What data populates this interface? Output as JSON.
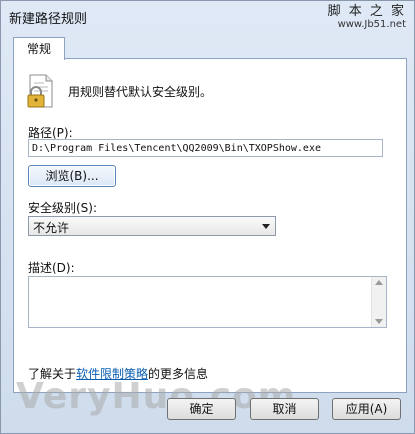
{
  "window": {
    "title": "新建路径规则"
  },
  "watermark": {
    "line1": "脚 本 之 家",
    "line2": "www.Jb51.net",
    "big": "VeryHuo.com"
  },
  "tabs": [
    {
      "label": "常规"
    }
  ],
  "general": {
    "description": "用规则替代默认安全级别。",
    "path_label": "路径(P):",
    "path_value": "D:\\Program Files\\Tencent\\QQ2009\\Bin\\TXOPShow.exe",
    "browse_label": "浏览(B)...",
    "security_level_label": "安全级别(S):",
    "security_level_value": "不允许",
    "describe_label": "描述(D):",
    "learn_prefix": "了解关于",
    "learn_link": "软件限制策略",
    "learn_suffix": "的更多信息"
  },
  "buttons": {
    "ok": "确定",
    "cancel": "取消",
    "apply": "应用(A)"
  },
  "colors": {
    "link": "#0b5fb3",
    "window_bg": "#dfe9f6"
  },
  "icons": {
    "rule": "lock-document-icon",
    "dropdown": "chevron-down-icon"
  }
}
